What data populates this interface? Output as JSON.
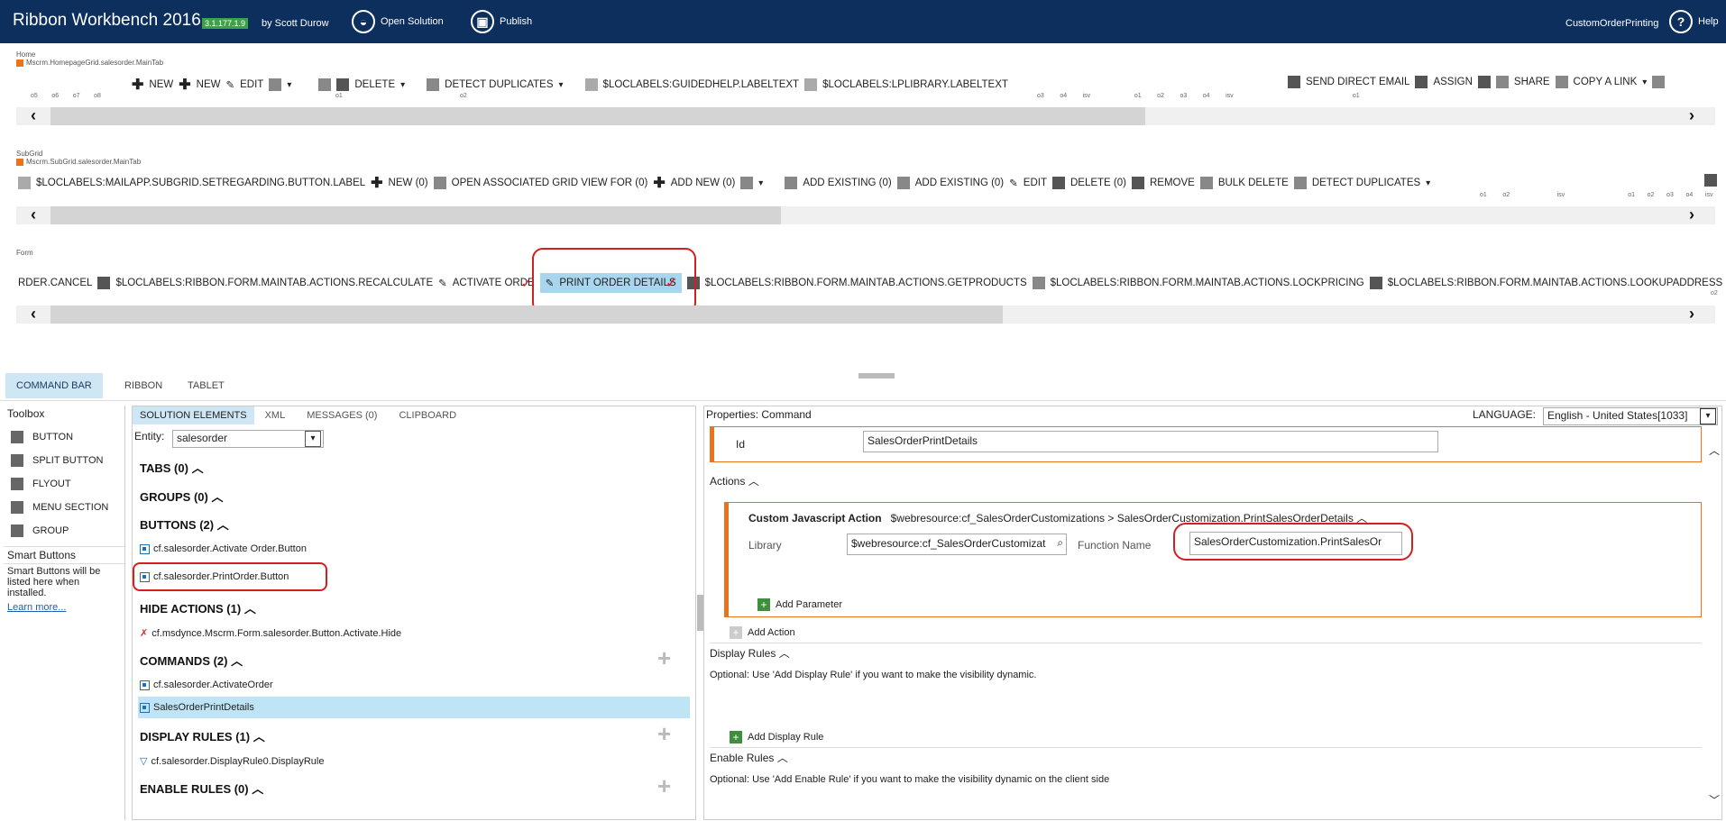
{
  "header": {
    "app_title": "Ribbon Workbench 2016",
    "version": "3.1.177.1.9",
    "by": "by Scott Durow",
    "open_solution": "Open Solution",
    "publish": "Publish",
    "solution_name": "CustomOrderPrinting",
    "help": "Help"
  },
  "home_section": {
    "label": "Home",
    "path": "Mscrm.HomepageGrid.salesorder.MainTab",
    "buttons": [
      "NEW",
      "NEW",
      "EDIT",
      "DELETE",
      "DETECT DUPLICATES",
      "$LOCLABELS:GUIDEDHELP.LABELTEXT",
      "$LOCLABELS:LPLIBRARY.LABELTEXT",
      "SEND DIRECT EMAIL",
      "ASSIGN",
      "SHARE",
      "COPY A LINK"
    ],
    "small_labels": [
      "o5",
      "o6",
      "o7",
      "o8",
      "o1",
      "o2",
      "o3",
      "o4",
      "isv",
      "o1",
      "o2",
      "o3",
      "o4",
      "isv",
      "o1"
    ]
  },
  "subgrid_section": {
    "label": "SubGrid",
    "path": "Mscrm.SubGrid.salesorder.MainTab",
    "buttons": [
      "$LOCLABELS:MAILAPP.SUBGRID.SETREGARDING.BUTTON.LABEL",
      "NEW (0)",
      "OPEN ASSOCIATED GRID VIEW FOR (0)",
      "ADD NEW (0)",
      "ADD EXISTING (0)",
      "ADD EXISTING (0)",
      "EDIT",
      "DELETE (0)",
      "REMOVE",
      "BULK DELETE",
      "DETECT DUPLICATES"
    ],
    "small_labels": [
      "o1",
      "o2",
      "isv",
      "o1",
      "o2",
      "o3",
      "o4",
      "isv"
    ]
  },
  "form_section": {
    "label": "Form",
    "buttons": [
      "RDER.CANCEL",
      "$LOCLABELS:RIBBON.FORM.MAINTAB.ACTIONS.RECALCULATE",
      "ACTIVATE ORDE",
      "PRINT ORDER DETAILS",
      "$LOCLABELS:RIBBON.FORM.MAINTAB.ACTIONS.GETPRODUCTS",
      "$LOCLABELS:RIBBON.FORM.MAINTAB.ACTIONS.LOCKPRICING",
      "$LOCLABELS:RIBBON.FORM.MAINTAB.ACTIONS.LOOKUPADDRESS"
    ],
    "small_label": "o2"
  },
  "bottom_tabs": [
    "COMMAND BAR",
    "RIBBON",
    "TABLET"
  ],
  "toolbox": {
    "title": "Toolbox",
    "items": [
      "BUTTON",
      "SPLIT BUTTON",
      "FLYOUT",
      "MENU SECTION",
      "GROUP"
    ],
    "smart_title": "Smart Buttons",
    "smart_text": "Smart Buttons will be listed here when installed.",
    "learn_more": "Learn more..."
  },
  "solution": {
    "tabs": [
      "SOLUTION ELEMENTS",
      "XML",
      "MESSAGES (0)",
      "CLIPBOARD"
    ],
    "entity_label": "Entity:",
    "entity_value": "salesorder",
    "tabs_head": "TABS (0)",
    "groups_head": "GROUPS (0)",
    "buttons_head": "BUTTONS (2)",
    "buttons": [
      "cf.salesorder.Activate Order.Button",
      "cf.salesorder.PrintOrder.Button"
    ],
    "hide_head": "HIDE ACTIONS (1)",
    "hide_items": [
      "cf.msdynce.Mscrm.Form.salesorder.Button.Activate.Hide"
    ],
    "commands_head": "COMMANDS (2)",
    "commands": [
      "cf.salesorder.ActivateOrder",
      "SalesOrderPrintDetails"
    ],
    "display_head": "DISPLAY RULES (1)",
    "display_items": [
      "cf.salesorder.DisplayRule0.DisplayRule"
    ],
    "enable_head": "ENABLE RULES (0)"
  },
  "properties": {
    "title": "Properties: Command",
    "language_label": "LANGUAGE:",
    "language_value": "English - United States[1033]",
    "id_label": "Id",
    "id_value": "SalesOrderPrintDetails",
    "actions_label": "Actions",
    "action_title": "Custom Javascript Action",
    "action_desc": "$webresource:cf_SalesOrderCustomizations > SalesOrderCustomization.PrintSalesOrderDetails",
    "library_label": "Library",
    "library_value": "$webresource:cf_SalesOrderCustomizat",
    "function_label": "Function Name",
    "function_value": "SalesOrderCustomization.PrintSalesOr",
    "add_parameter": "Add Parameter",
    "add_action": "Add Action",
    "display_rules_label": "Display Rules",
    "display_rules_text": "Optional: Use 'Add Display Rule' if you want to make the visibility dynamic.",
    "add_display_rule": "Add Display Rule",
    "enable_rules_label": "Enable Rules",
    "enable_rules_text": "Optional: Use 'Add Enable Rule' if you want to make the visibility dynamic on the client side"
  }
}
